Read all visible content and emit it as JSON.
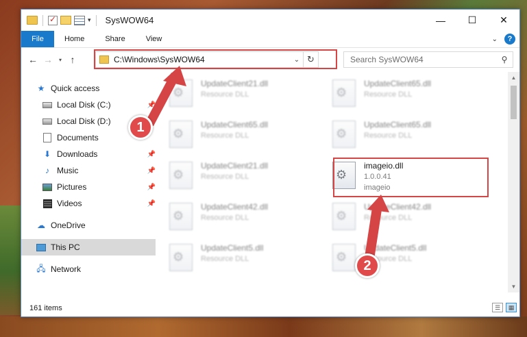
{
  "window": {
    "title": "SysWOW64",
    "controls": {
      "minimize": "—",
      "maximize": "☐",
      "close": "✕"
    }
  },
  "quick_access_toolbar": {
    "icons": [
      "folder-icon",
      "properties-icon",
      "new-folder-icon",
      "customize-icon",
      "view-icon"
    ],
    "customize_glyph": "▾"
  },
  "ribbon": {
    "tabs": [
      {
        "label": "File",
        "active": true
      },
      {
        "label": "Home"
      },
      {
        "label": "Share"
      },
      {
        "label": "View"
      }
    ],
    "expand_glyph": "⌄",
    "help_glyph": "?"
  },
  "navigation": {
    "back_glyph": "←",
    "forward_glyph": "→",
    "recent_glyph": "▾",
    "up_glyph": "↑"
  },
  "address_bar": {
    "path": "C:\\Windows\\SysWOW64",
    "dropdown_glyph": "⌄",
    "refresh_glyph": "↻"
  },
  "search": {
    "placeholder": "Search SysWOW64",
    "icon_glyph": "⚲"
  },
  "nav_pane": {
    "quick_access": {
      "label": "Quick access",
      "icon": "star-icon",
      "glyph": "★",
      "color": "#2b78d0"
    },
    "pinned": [
      {
        "label": "Local Disk (C:)",
        "icon": "drive-icon"
      },
      {
        "label": "Local Disk (D:)",
        "icon": "drive-icon"
      },
      {
        "label": "Documents",
        "icon": "documents-icon"
      },
      {
        "label": "Downloads",
        "icon": "downloads-icon",
        "glyph": "⬇"
      },
      {
        "label": "Music",
        "icon": "music-icon",
        "glyph": "♪"
      },
      {
        "label": "Pictures",
        "icon": "pictures-icon"
      },
      {
        "label": "Videos",
        "icon": "videos-icon"
      }
    ],
    "pin_glyph": "📌",
    "onedrive": {
      "label": "OneDrive",
      "icon": "cloud-icon",
      "glyph": "☁"
    },
    "this_pc": {
      "label": "This PC",
      "icon": "computer-icon",
      "selected": true
    },
    "network": {
      "label": "Network",
      "icon": "network-icon",
      "glyph": "🖧"
    }
  },
  "files": {
    "focused": {
      "name": "imageio.dll",
      "version": "1.0.0.41",
      "description": "imageio"
    },
    "blurred": [
      {
        "name": "UpdateClient21.dll",
        "type": "Resource DLL"
      },
      {
        "name": "UpdateClient65.dll",
        "type": "Resource DLL"
      },
      {
        "name": "UpdateClient65.dll",
        "type": "Resource DLL"
      },
      {
        "name": "UpdateClient65.dll",
        "type": "Resource DLL"
      },
      {
        "name": "UpdateClient21.dll",
        "type": "Resource DLL"
      },
      {
        "name": "UpdateClient42.dll",
        "type": "Resource DLL"
      },
      {
        "name": "UpdateClient42.dll",
        "type": "Resource DLL"
      },
      {
        "name": "UpdateClient5.dll",
        "type": "Resource DLL"
      },
      {
        "name": "UpdateClient5.dll",
        "type": "Resource DLL"
      }
    ]
  },
  "scrollbar": {
    "up_glyph": "▲",
    "down_glyph": "▼"
  },
  "status_bar": {
    "item_count": "161 items",
    "details_view_glyph": "☰",
    "tiles_view_glyph": "▦"
  },
  "annotations": {
    "marker_1": "1",
    "marker_2": "2",
    "color": "#d64545"
  }
}
